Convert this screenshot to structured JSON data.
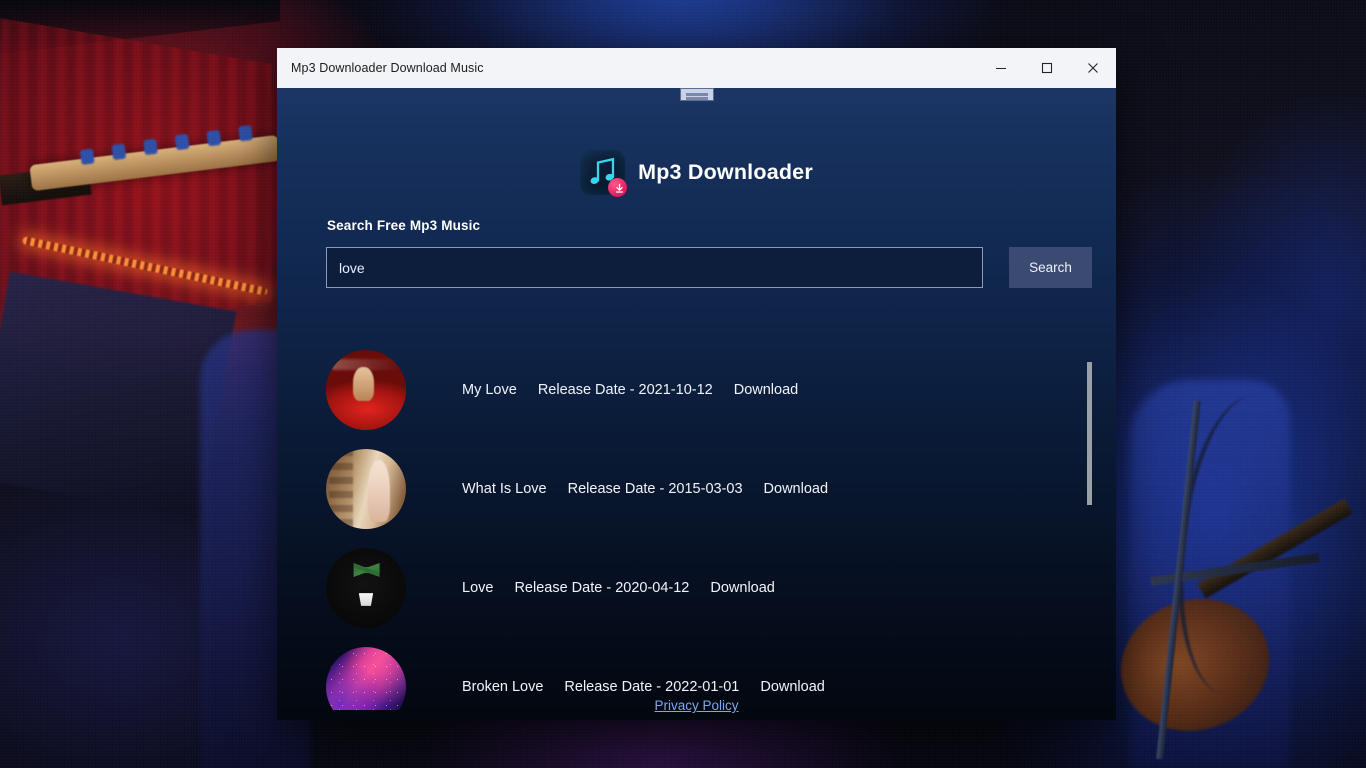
{
  "window": {
    "title": "Mp3 Downloader Download Music",
    "controls": {
      "minimize": "–",
      "maximize": "☐",
      "close": "✕"
    }
  },
  "app": {
    "title": "Mp3 Downloader",
    "logo_icon": "music-note-download-icon",
    "accent_color": "#e01a5e",
    "note_color": "#35d7e8",
    "background_top": "#1b3665",
    "background_bottom": "#03070f"
  },
  "search": {
    "label": "Search Free Mp3 Music",
    "value": "love",
    "placeholder": "",
    "button_label": "Search",
    "button_color": "#3a4a70"
  },
  "results": [
    {
      "title": "My Love",
      "release": "Release Date - 2021-10-12",
      "download_label": "Download",
      "art": "art-car"
    },
    {
      "title": "What Is Love",
      "release": "Release Date - 2015-03-03",
      "download_label": "Download",
      "art": "art-beige"
    },
    {
      "title": "Love",
      "release": "Release Date - 2020-04-12",
      "download_label": "Download",
      "art": "art-plant"
    },
    {
      "title": "Broken Love",
      "release": "Release Date - 2022-01-01",
      "download_label": "Download",
      "art": "art-nebula"
    }
  ],
  "footer": {
    "privacy_policy": "Privacy Policy",
    "link_color": "#7ea8e8"
  }
}
